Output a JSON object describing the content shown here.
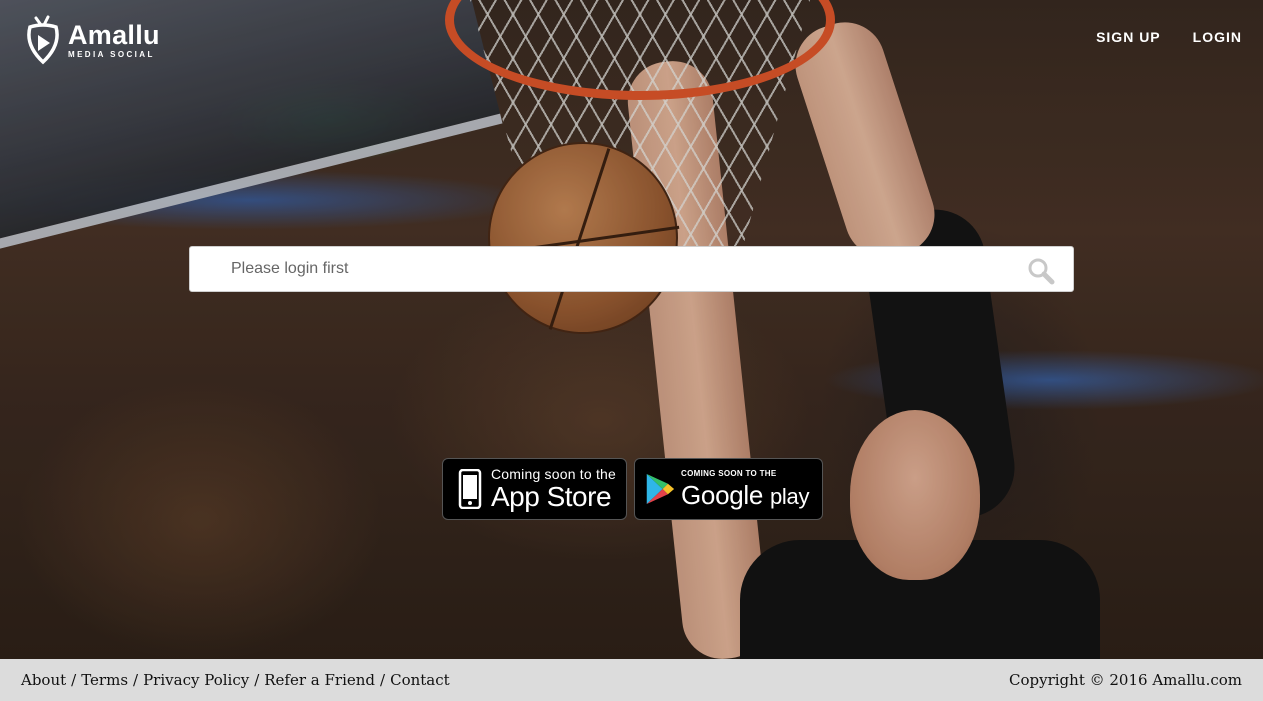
{
  "brand": {
    "name": "Amallu",
    "tagline": "MEDIA SOCIAL"
  },
  "nav": {
    "signup": "SIGN UP",
    "login": "LOGIN"
  },
  "search": {
    "placeholder": "Please login first",
    "icon": "search-icon"
  },
  "badges": {
    "apple": {
      "small": "Coming soon to the",
      "big": "App Store",
      "icon": "phone-icon"
    },
    "google": {
      "small": "COMING SOON TO THE",
      "big": "Google",
      "big_suffix": "play",
      "icon": "google-play-icon"
    }
  },
  "footer": {
    "links": [
      "About",
      "Terms",
      "Privacy Policy",
      "Refer a Friend",
      "Contact"
    ],
    "separator": "/",
    "copyright": "Copyright © 2016 Amallu.com"
  },
  "colors": {
    "footer_bg": "#dcdcdc",
    "rim": "#e2572b",
    "badge_bg": "#000000"
  }
}
